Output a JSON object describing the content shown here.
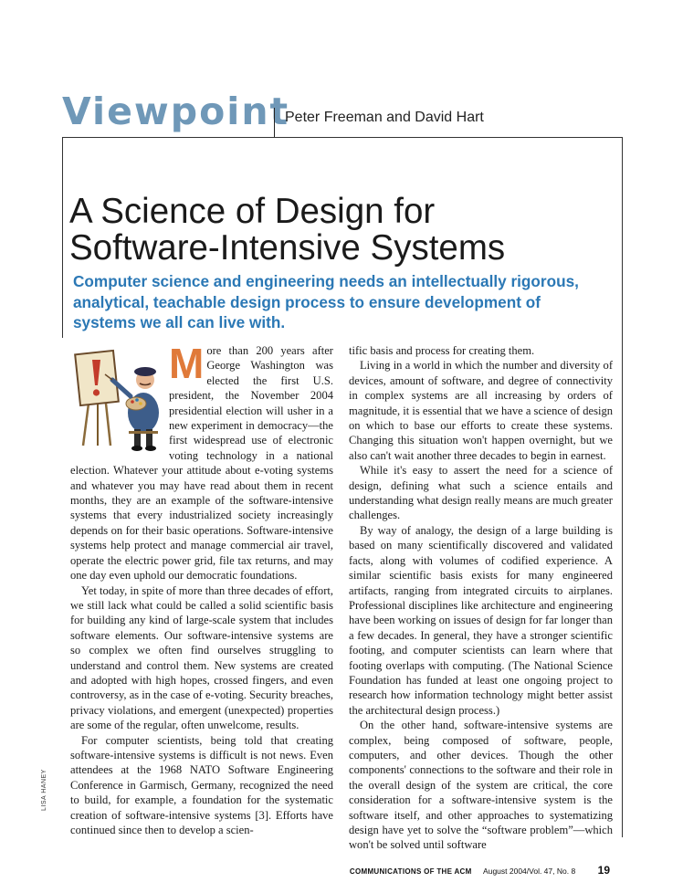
{
  "header": {
    "section": "Viewpoint",
    "authors": "Peter Freeman and David Hart"
  },
  "title_lines": [
    "A Science of Design for",
    "Software-Intensive Systems"
  ],
  "deck_lines": [
    "Computer science and engineering needs an intellectually rigorous,",
    "analytical, teachable design process to ensure development of",
    "systems we all can live with."
  ],
  "body": {
    "drop_cap": "M",
    "left_col": [
      "ore than 200 years after George Washington was elected the first U.S. president, the November 2004 presidential election will usher in a new experiment in democracy—the first widespread use of electronic voting technology in a national election. Whatever your attitude about e-voting systems and whatever you may have read about them in recent months, they are an example of the software-intensive systems that every industrialized society increasingly depends on for their basic operations. Software-intensive systems help protect and manage commercial air travel, operate the electric power grid, file tax returns, and may one day even uphold our democratic foundations.",
      "Yet today, in spite of more than three decades of effort, we still lack what could be called a solid scientific basis for building any kind of large-scale system that includes software elements. Our software-intensive systems are so complex we often find ourselves struggling to understand and control them. New systems are created and adopted with high hopes, crossed fingers, and even controversy, as in the case of e-voting. Security breaches, privacy violations, and emergent (unexpected) properties are some of the regular, often unwelcome, results.",
      "For computer scientists, being told that creating software-intensive systems is difficult is not news. Even attendees at the 1968 NATO Software Engineering Conference in Garmisch, Germany, recognized the need to build, for example, a foundation for the systematic creation of software-intensive systems [3]. Efforts have continued since then to develop a scien-"
    ],
    "right_col": [
      "tific basis and process for creating them.",
      "Living in a world in which the number and diversity of devices, amount of software, and degree of connectivity in complex systems are all increasing by orders of magnitude, it is essential that we have a science of design on which to base our efforts to create these systems. Changing this situation won't happen overnight, but we also can't wait another three decades to begin in earnest.",
      "While it's easy to assert the need for a science of design, defining what such a science entails and understanding what design really means are much greater challenges.",
      "By way of analogy, the design of a large building is based on many scientifically discovered and validated facts, along with volumes of codified experience. A similar scientific basis exists for many engineered artifacts, ranging from integrated circuits to airplanes. Professional disciplines like architecture and engineering have been working on issues of design for far longer than a few decades. In general, they have a stronger scientific footing, and computer scientists can learn where that footing overlaps with computing. (The National Science Foundation has funded at least one ongoing project to research how information technology might better assist the architectural design process.)",
      "On the other hand, software-intensive systems are complex, being composed of software, people, computers, and other devices. Though the other components' connections to the software and their role in the overall design of the system are critical, the core consideration for a software-intensive system is the software itself, and other approaches to systematizing design have yet to solve the “software problem”—which won't be solved until software"
    ]
  },
  "credit": "LISA HANEY",
  "footer": {
    "journal": "COMMUNICATIONS OF THE ACM",
    "issue": "August 2004/Vol. 47, No. 8",
    "page": "19"
  },
  "colors": {
    "section": "#6f98b8",
    "deck": "#2b78b5",
    "drop_cap": "#e07a3a"
  }
}
